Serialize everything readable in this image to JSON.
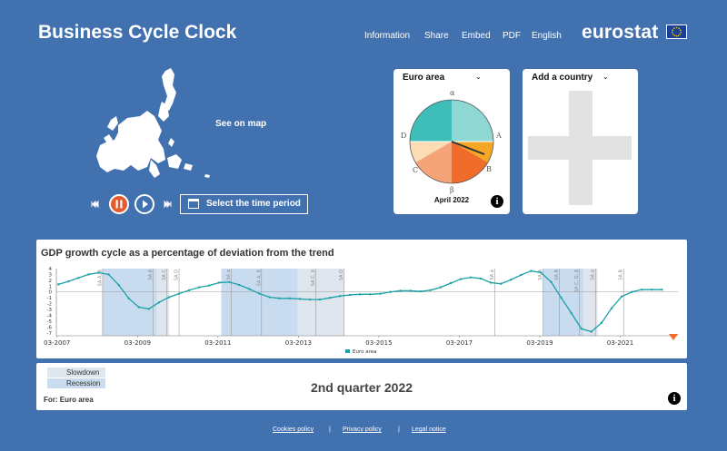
{
  "header": {
    "title": "Business Cycle Clock",
    "nav": [
      "Information",
      "Share",
      "Embed",
      "PDF",
      "English"
    ],
    "logo": "eurostat"
  },
  "map": {
    "label": "See on map"
  },
  "controls": {
    "period_button": "Select the time period"
  },
  "cycle_card": {
    "country": "Euro area",
    "period": "April 2022",
    "axis_labels": {
      "top": "α",
      "right": "A",
      "lower_right": "B",
      "bottom": "β",
      "lower_left": "C",
      "left": "D"
    },
    "colors": {
      "top_left": "#3fbdb8",
      "top_right": "#8fd7d3",
      "right_1": "#f5a623",
      "right_2": "#ef6c2b",
      "left_1": "#f4a477",
      "left_2": "#fbdcb4"
    }
  },
  "add_card": {
    "label": "Add a country"
  },
  "chart_data": {
    "type": "line",
    "title": "GDP growth cycle as a percentage of deviation from the trend",
    "legend": [
      "Euro area"
    ],
    "y_ticks": [
      "4",
      "3",
      "2",
      "1",
      "0",
      "-1",
      "-2",
      "-3",
      "-4",
      "-5",
      "-6",
      "-7"
    ],
    "x_ticks": [
      "03-2007",
      "03-2009",
      "03-2011",
      "03-2013",
      "03-2015",
      "03-2017",
      "03-2019",
      "03-2021"
    ],
    "ylim": [
      -7.5,
      4
    ],
    "xlim": [
      2007.15,
      2022.6
    ],
    "series": [
      {
        "name": "Euro area",
        "color": "#1aa0a6",
        "x": [
          2007.2,
          2007.45,
          2007.7,
          2007.95,
          2008.2,
          2008.45,
          2008.7,
          2008.95,
          2009.2,
          2009.45,
          2009.7,
          2009.95,
          2010.2,
          2010.45,
          2010.7,
          2010.95,
          2011.2,
          2011.45,
          2011.7,
          2011.95,
          2012.2,
          2012.45,
          2012.7,
          2012.95,
          2013.2,
          2013.45,
          2013.7,
          2013.95,
          2014.2,
          2014.45,
          2014.7,
          2014.95,
          2015.2,
          2015.45,
          2015.7,
          2015.95,
          2016.2,
          2016.45,
          2016.7,
          2016.95,
          2017.2,
          2017.45,
          2017.7,
          2017.95,
          2018.2,
          2018.45,
          2018.7,
          2018.95,
          2019.2,
          2019.45,
          2019.7,
          2019.95,
          2020.2,
          2020.45,
          2020.7,
          2020.95,
          2021.2,
          2021.45,
          2021.7,
          2021.95,
          2022.2
        ],
        "values": [
          1.3,
          1.8,
          2.4,
          3.0,
          3.3,
          3.0,
          1.2,
          -1.1,
          -2.6,
          -2.9,
          -1.8,
          -0.9,
          -0.3,
          0.3,
          0.8,
          1.1,
          1.6,
          1.7,
          1.2,
          0.5,
          -0.3,
          -0.9,
          -1.1,
          -1.1,
          -1.2,
          -1.3,
          -1.3,
          -1.0,
          -0.7,
          -0.5,
          -0.4,
          -0.4,
          -0.3,
          0.0,
          0.2,
          0.2,
          0.1,
          0.3,
          0.8,
          1.5,
          2.2,
          2.5,
          2.3,
          1.6,
          1.4,
          2.1,
          2.9,
          3.6,
          3.3,
          1.7,
          -1.0,
          -3.6,
          -6.3,
          -6.8,
          -5.3,
          -2.8,
          -0.8,
          0.0,
          0.4,
          0.4,
          0.4
        ]
      }
    ],
    "shaded_regions": [
      {
        "start": 2008.3,
        "end": 2009.65,
        "type": "Recession"
      },
      {
        "start": 2009.65,
        "end": 2009.95,
        "type": "Slowdown"
      },
      {
        "start": 2011.25,
        "end": 2013.15,
        "type": "Recession"
      },
      {
        "start": 2013.15,
        "end": 2014.3,
        "type": "Slowdown"
      },
      {
        "start": 2019.25,
        "end": 2020.25,
        "type": "Recession"
      },
      {
        "start": 2020.25,
        "end": 2020.6,
        "type": "Slowdown"
      }
    ],
    "vlines": [
      {
        "x": 2008.3,
        "label": "SA A, B"
      },
      {
        "x": 2009.55,
        "label": "SA β"
      },
      {
        "x": 2009.9,
        "label": "SA C"
      },
      {
        "x": 2010.2,
        "label": "SA D"
      },
      {
        "x": 2011.5,
        "label": "SA α"
      },
      {
        "x": 2012.25,
        "label": "SA A, B"
      },
      {
        "x": 2013.6,
        "label": "SA C, β"
      },
      {
        "x": 2014.3,
        "label": "SA D"
      },
      {
        "x": 2018.05,
        "label": "SA α"
      },
      {
        "x": 2019.25,
        "label": "SA A"
      },
      {
        "x": 2019.65,
        "label": "SA B"
      },
      {
        "x": 2020.15,
        "label": "SA C, D, β"
      },
      {
        "x": 2020.55,
        "label": "SA α"
      },
      {
        "x": 2021.25,
        "label": "SA B"
      }
    ]
  },
  "legend_panel": {
    "slowdown": "Slowdown",
    "recession": "Recession",
    "for_label": "For: Euro area",
    "quarter": "2nd quarter 2022"
  },
  "footer": [
    "Cookies policy",
    "Privacy policy",
    "Legal notice"
  ]
}
